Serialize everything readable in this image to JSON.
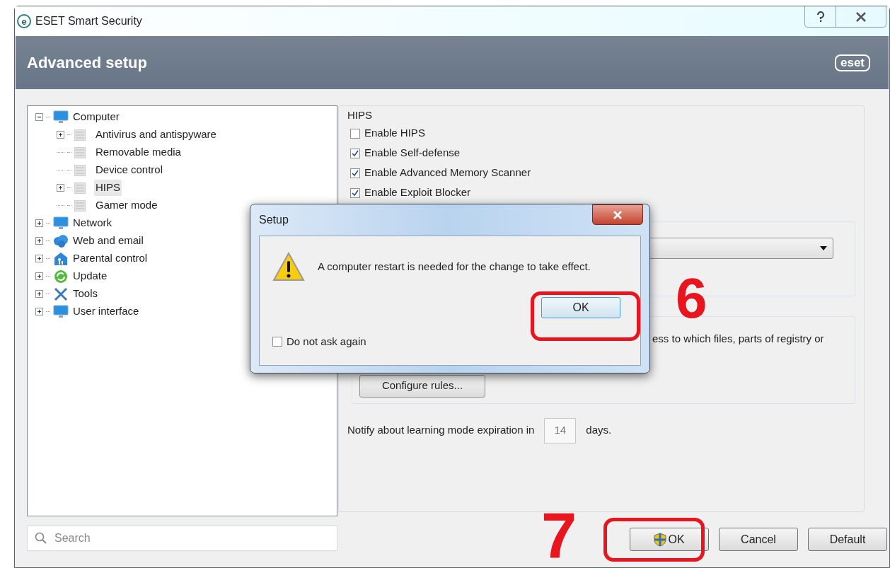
{
  "window": {
    "app_icon_letter": "e",
    "title": "ESET Smart Security"
  },
  "header": {
    "title": "Advanced setup",
    "logo": "eset"
  },
  "tree": [
    {
      "label": "Computer",
      "expanded": true,
      "selected": false,
      "children": [
        {
          "label": "Antivirus and antispyware",
          "selected": false,
          "has_children": true
        },
        {
          "label": "Removable media",
          "selected": false,
          "has_children": false
        },
        {
          "label": "Device control",
          "selected": false,
          "has_children": false
        },
        {
          "label": "HIPS",
          "selected": true,
          "has_children": true
        },
        {
          "label": "Gamer mode",
          "selected": false,
          "has_children": false
        }
      ]
    },
    {
      "label": "Network",
      "expanded": false,
      "selected": false
    },
    {
      "label": "Web and email",
      "expanded": false,
      "selected": false
    },
    {
      "label": "Parental control",
      "expanded": false,
      "selected": false
    },
    {
      "label": "Update",
      "expanded": false,
      "selected": false
    },
    {
      "label": "Tools",
      "expanded": false,
      "selected": false
    },
    {
      "label": "User interface",
      "expanded": false,
      "selected": false
    }
  ],
  "search": {
    "placeholder": "Search"
  },
  "hips": {
    "legend": "HIPS",
    "options": [
      {
        "label": "Enable HIPS",
        "checked": false
      },
      {
        "label": "Enable Self-defense",
        "checked": true
      },
      {
        "label": "Enable Advanced Memory Scanner",
        "checked": true
      },
      {
        "label": "Enable Exploit Blocker",
        "checked": true
      }
    ],
    "rules_text": "ess to which files, parts of registry or",
    "configure_button": "Configure rules...",
    "notify_before": "Notify about learning mode expiration in",
    "notify_value": "14",
    "notify_after": "days."
  },
  "buttons": [
    "OK",
    "Cancel",
    "Default"
  ],
  "dialog": {
    "title": "Setup",
    "message": "A computer restart is needed for the change to take effect.",
    "ok": "OK",
    "do_not_ask": {
      "label": "Do not ask again",
      "checked": false
    }
  },
  "annotations": [
    "6",
    "7"
  ]
}
